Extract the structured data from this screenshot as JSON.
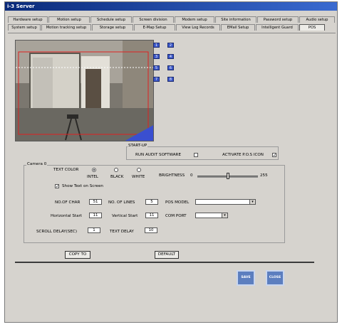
{
  "window": {
    "title": "i-3 Server"
  },
  "tabs_row1": [
    "Hardware setup",
    "Motion setup",
    "Schedule setup",
    "Screen division",
    "Modem setup",
    "Site information",
    "Password setup",
    "Audio setup"
  ],
  "tabs_row2": [
    "System setup",
    "Motion tracking setup",
    "Storage setup",
    "E-Map Setup",
    "View Log Records",
    "EMail Setup",
    "Intelligent Guard",
    "POS"
  ],
  "active_tab": "POS",
  "camera_buttons": [
    "1",
    "2",
    "3",
    "4",
    "5",
    "6",
    "7",
    "8"
  ],
  "startup": {
    "title": "START-UP",
    "run_audit_label": "RUN AUDIT SOFTWARE",
    "run_audit_checked": false,
    "activate_pos_label": "ACTIVATE P.O.S ICON",
    "activate_pos_checked": true
  },
  "camera_group": {
    "title": "Camera 0",
    "text_color_label": "TEXT COLOR",
    "colors": [
      {
        "label": "INTEL",
        "selected": true
      },
      {
        "label": "BLACK",
        "selected": false
      },
      {
        "label": "WHITE",
        "selected": false
      }
    ],
    "brightness_label": "BRIGHTNESS",
    "brightness_min": "0",
    "brightness_max": "255",
    "brightness_level": 0.5,
    "show_text_label": "Show Text on Screen",
    "show_text_checked": true,
    "no_of_char_label": "NO.OF CHAR",
    "no_of_char_value": "51",
    "no_of_lines_label": "NO. OF LINES",
    "no_of_lines_value": "5",
    "pos_model_label": "POS MODEL",
    "pos_model_value": "",
    "horizontal_start_label": "Horizontal Start",
    "horizontal_start_value": "11",
    "vertical_start_label": "Vertical Start",
    "vertical_start_value": "11",
    "com_port_label": "COM PORT",
    "com_port_value": "",
    "scroll_delay_label": "SCROLL DELAY(SEC)",
    "scroll_delay_value": "1",
    "text_delay_label": "TEXT DELAY",
    "text_delay_value": "10"
  },
  "buttons": {
    "copy_to": "COPY TO",
    "default": "DEFAULT",
    "save": "SAVE",
    "close": "CLOSE"
  },
  "colors": {
    "title_bar": "#0a2a7a",
    "accent_button": "#5c7ebf",
    "window_bg": "#d6d3ce"
  }
}
